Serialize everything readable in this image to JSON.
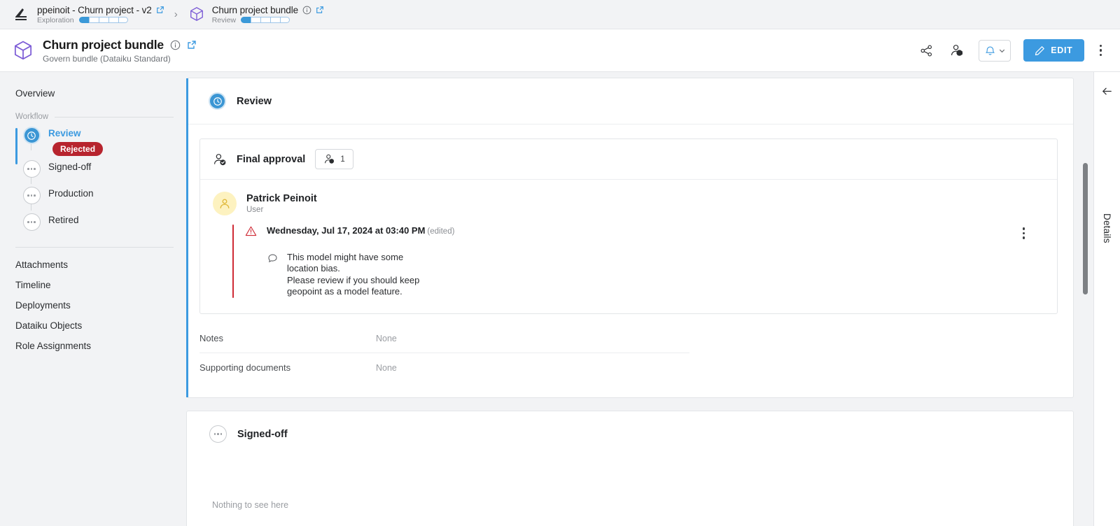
{
  "breadcrumb": {
    "items": [
      {
        "icon": "dataiku-bird-icon",
        "title": "ppeinoit - Churn project - v2",
        "stage": "Exploration",
        "progress_filled": 1,
        "progress_total": 5,
        "has_external_link": true,
        "has_info": false
      },
      {
        "icon": "bundle-cube-icon",
        "title": "Churn project bundle",
        "stage": "Review",
        "progress_filled": 1,
        "progress_total": 5,
        "has_external_link": true,
        "has_info": true
      }
    ],
    "separator": "›"
  },
  "header": {
    "icon": "bundle-cube-icon",
    "title": "Churn project bundle",
    "subtitle": "Govern bundle (Dataiku Standard)",
    "info_icon": "info-icon",
    "external_link_icon": "external-link-icon",
    "actions": {
      "share_icon": "share-nodes-icon",
      "user_icon": "user-tag-icon",
      "bell_icon": "bell-icon",
      "bell_chevron_icon": "chevron-down-icon",
      "edit_label": "EDIT",
      "edit_icon": "pencil-icon",
      "more_icon": "kebab-menu-icon"
    }
  },
  "sidebar": {
    "overview_label": "Overview",
    "workflow_label": "Workflow",
    "workflow_steps": [
      {
        "label": "Review",
        "state": "active",
        "badge": "Rejected"
      },
      {
        "label": "Signed-off",
        "state": "pending",
        "badge": null
      },
      {
        "label": "Production",
        "state": "pending",
        "badge": null
      },
      {
        "label": "Retired",
        "state": "pending",
        "badge": null
      }
    ],
    "links": [
      "Attachments",
      "Timeline",
      "Deployments",
      "Dataiku Objects",
      "Role Assignments"
    ]
  },
  "main": {
    "review_card": {
      "icon": "clock-step-icon",
      "title": "Review",
      "approval_panel": {
        "icon": "user-check-icon",
        "title": "Final approval",
        "count_icon": "user-tag-icon",
        "count": "1",
        "person": {
          "avatar_icon": "user-avatar-icon",
          "name": "Patrick Peinoit",
          "role": "User"
        },
        "comment": {
          "status_icon": "warning-triangle-icon",
          "date": "Wednesday, Jul 17, 2024 at 03:40 PM",
          "edited_label": "(edited)",
          "menu_icon": "kebab-menu-icon",
          "bubble_icon": "comment-bubble-icon",
          "text": "This model might have some\nlocation bias.\nPlease review if you should keep\ngeopoint as a model feature."
        }
      },
      "fields": [
        {
          "key": "Notes",
          "value": "None"
        },
        {
          "key": "Supporting documents",
          "value": "None"
        }
      ]
    },
    "signed_off_card": {
      "icon": "pending-dots-icon",
      "title": "Signed-off",
      "empty_text": "Nothing to see here"
    }
  },
  "right_rail": {
    "collapse_icon": "arrow-left-icon",
    "label": "Details"
  },
  "colors": {
    "accent_blue": "#3c9ae0",
    "step_blue": "#3b96d4",
    "rejected_red": "#b7242e",
    "comment_red": "#cf2b36",
    "bundle_purple": "#7c5cd6",
    "avatar_yellow": "#fdf2c0",
    "page_bg": "#f2f3f5"
  }
}
